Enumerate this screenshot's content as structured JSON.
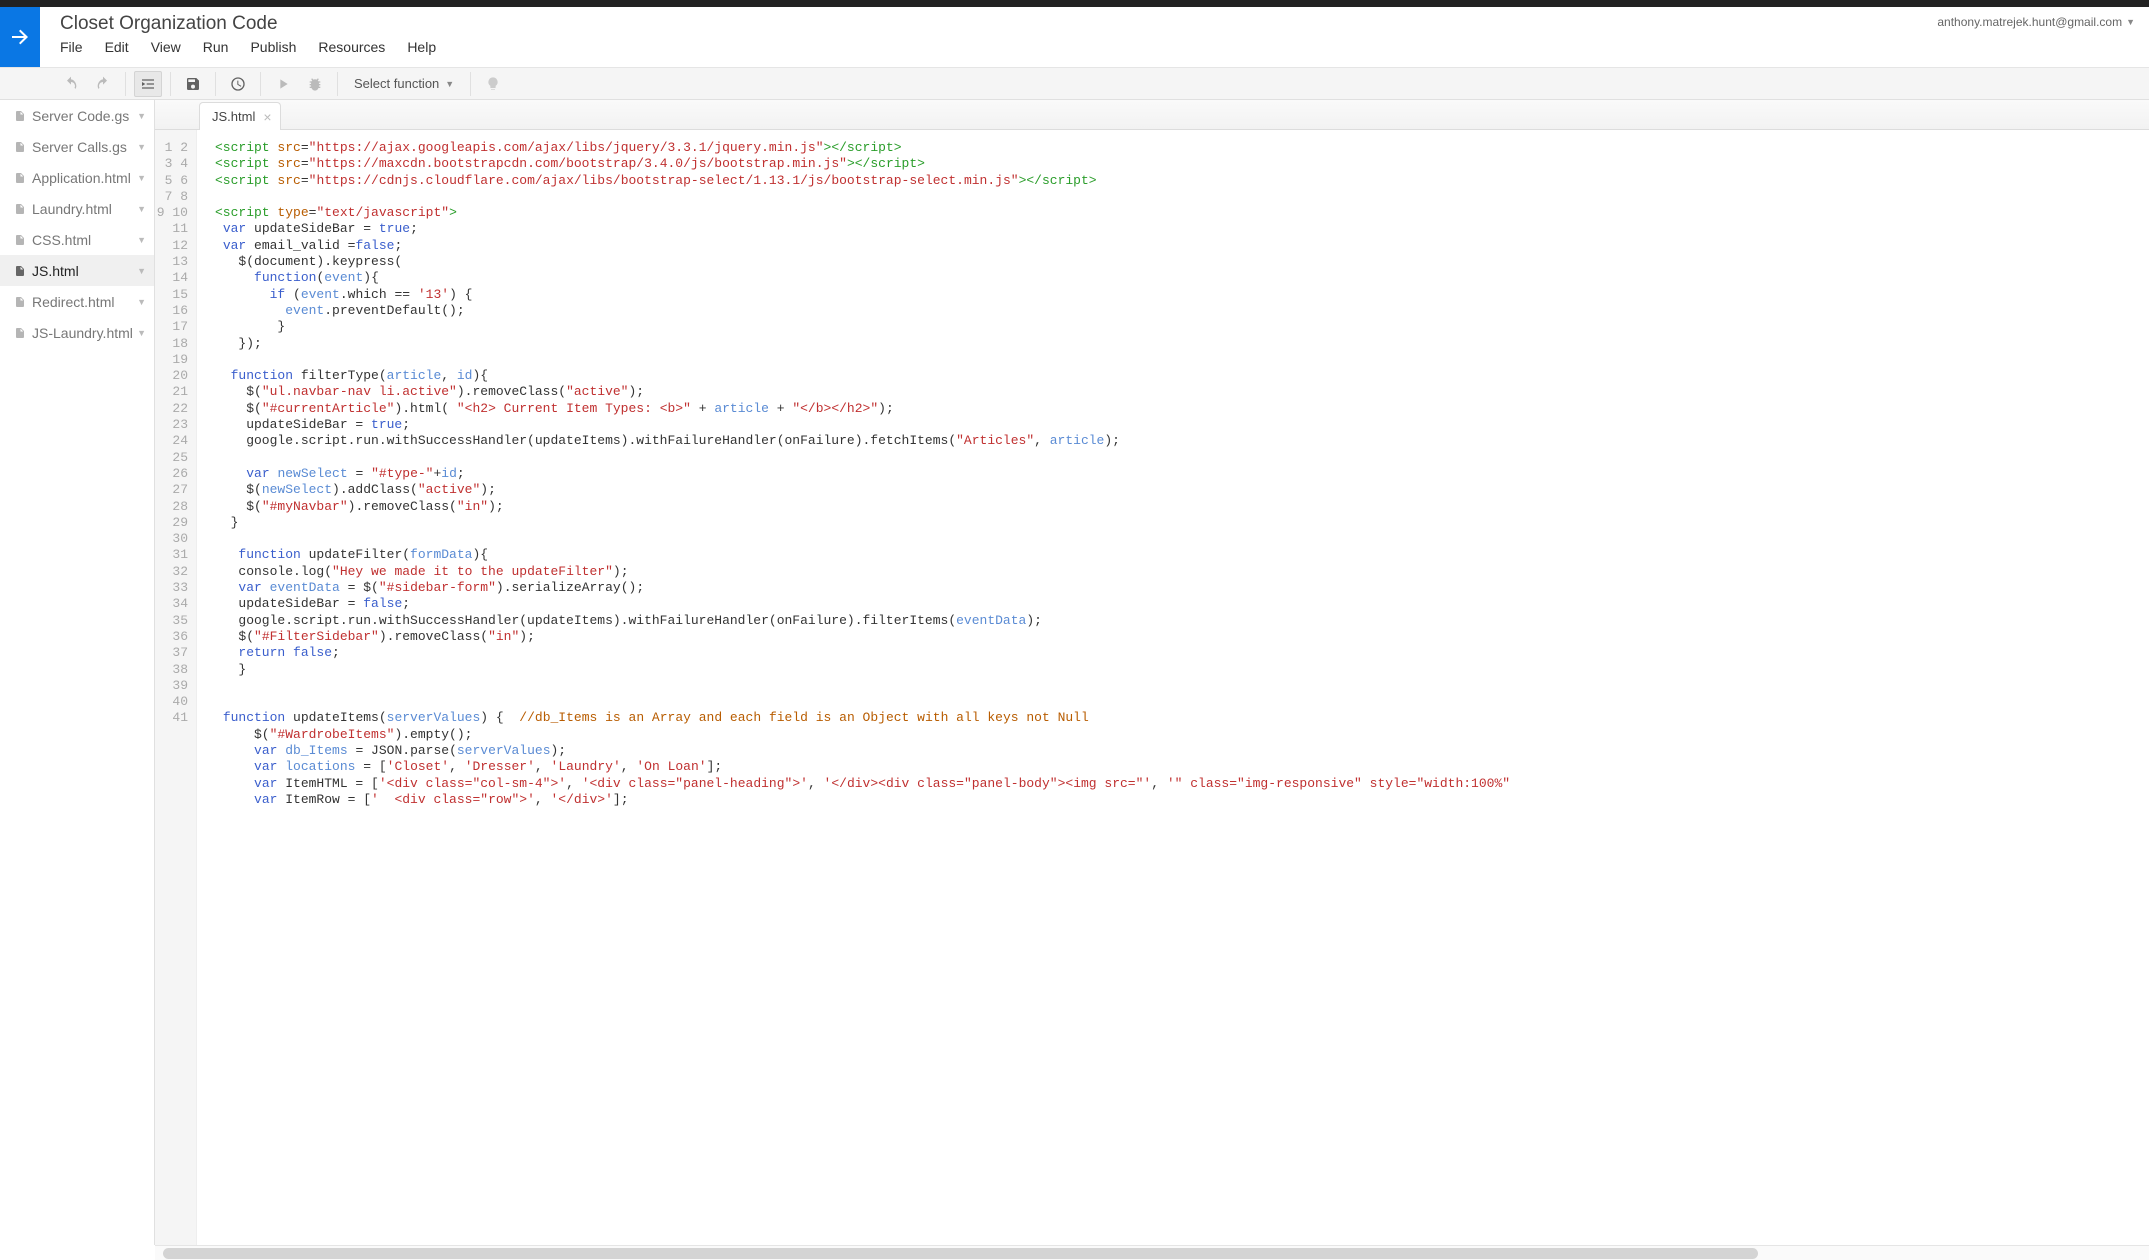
{
  "project_title": "Closet Organization Code",
  "user_email": "anthony.matrejek.hunt@gmail.com",
  "menubar": [
    "File",
    "Edit",
    "View",
    "Run",
    "Publish",
    "Resources",
    "Help"
  ],
  "toolbar": {
    "select_fn": "Select function"
  },
  "sidebar": {
    "items": [
      {
        "label": "Server Code.gs"
      },
      {
        "label": "Server Calls.gs"
      },
      {
        "label": "Application.html"
      },
      {
        "label": "Laundry.html"
      },
      {
        "label": "CSS.html"
      },
      {
        "label": "JS.html",
        "active": true
      },
      {
        "label": "Redirect.html"
      },
      {
        "label": "JS-Laundry.html"
      }
    ]
  },
  "editor": {
    "tab": "JS.html",
    "line_start": 1,
    "line_end": 41,
    "code_lines": [
      {
        "n": 1,
        "t": [
          [
            "tag",
            "<script"
          ],
          [
            "pl",
            " "
          ],
          [
            "attr",
            "src"
          ],
          [
            "pl",
            "="
          ],
          [
            "str",
            "\"https://ajax.googleapis.com/ajax/libs/jquery/3.3.1/jquery.min.js\""
          ],
          [
            "tag",
            "></script>"
          ]
        ]
      },
      {
        "n": 2,
        "t": [
          [
            "tag",
            "<script"
          ],
          [
            "pl",
            " "
          ],
          [
            "attr",
            "src"
          ],
          [
            "pl",
            "="
          ],
          [
            "str",
            "\"https://maxcdn.bootstrapcdn.com/bootstrap/3.4.0/js/bootstrap.min.js\""
          ],
          [
            "tag",
            "></script>"
          ]
        ]
      },
      {
        "n": 3,
        "t": [
          [
            "tag",
            "<script"
          ],
          [
            "pl",
            " "
          ],
          [
            "attr",
            "src"
          ],
          [
            "pl",
            "="
          ],
          [
            "str",
            "\"https://cdnjs.cloudflare.com/ajax/libs/bootstrap-select/1.13.1/js/bootstrap-select.min.js\""
          ],
          [
            "tag",
            "></script>"
          ]
        ]
      },
      {
        "n": 4,
        "t": []
      },
      {
        "n": 5,
        "t": [
          [
            "tag",
            "<script"
          ],
          [
            "pl",
            " "
          ],
          [
            "attr",
            "type"
          ],
          [
            "pl",
            "="
          ],
          [
            "str",
            "\"text/javascript\""
          ],
          [
            "tag",
            ">"
          ]
        ]
      },
      {
        "n": 6,
        "t": [
          [
            "pl",
            " "
          ],
          [
            "kw",
            "var"
          ],
          [
            "pl",
            " updateSideBar = "
          ],
          [
            "kw",
            "true"
          ],
          [
            "pl",
            ";"
          ]
        ]
      },
      {
        "n": 7,
        "t": [
          [
            "pl",
            " "
          ],
          [
            "kw",
            "var"
          ],
          [
            "pl",
            " email_valid ="
          ],
          [
            "kw",
            "false"
          ],
          [
            "pl",
            ";"
          ]
        ]
      },
      {
        "n": 8,
        "t": [
          [
            "pl",
            "   $(document).keypress("
          ]
        ]
      },
      {
        "n": 9,
        "t": [
          [
            "pl",
            "     "
          ],
          [
            "kw",
            "function"
          ],
          [
            "pl",
            "("
          ],
          [
            "id",
            "event"
          ],
          [
            "pl",
            "){"
          ]
        ]
      },
      {
        "n": 10,
        "t": [
          [
            "pl",
            "       "
          ],
          [
            "kw",
            "if"
          ],
          [
            "pl",
            " ("
          ],
          [
            "id",
            "event"
          ],
          [
            "pl",
            ".which == "
          ],
          [
            "str",
            "'13'"
          ],
          [
            "pl",
            ") {"
          ]
        ]
      },
      {
        "n": 11,
        "t": [
          [
            "pl",
            "         "
          ],
          [
            "id",
            "event"
          ],
          [
            "pl",
            ".preventDefault();"
          ]
        ]
      },
      {
        "n": 12,
        "t": [
          [
            "pl",
            "        }"
          ]
        ]
      },
      {
        "n": 13,
        "t": [
          [
            "pl",
            "   });"
          ]
        ]
      },
      {
        "n": 14,
        "t": []
      },
      {
        "n": 15,
        "t": [
          [
            "pl",
            "  "
          ],
          [
            "kw",
            "function"
          ],
          [
            "pl",
            " filterType("
          ],
          [
            "id",
            "article"
          ],
          [
            "pl",
            ", "
          ],
          [
            "id",
            "id"
          ],
          [
            "pl",
            "){"
          ]
        ]
      },
      {
        "n": 16,
        "t": [
          [
            "pl",
            "    $("
          ],
          [
            "str",
            "\"ul.navbar-nav li.active\""
          ],
          [
            "pl",
            ").removeClass("
          ],
          [
            "str",
            "\"active\""
          ],
          [
            "pl",
            ");"
          ]
        ]
      },
      {
        "n": 17,
        "t": [
          [
            "pl",
            "    $("
          ],
          [
            "str",
            "\"#currentArticle\""
          ],
          [
            "pl",
            ").html( "
          ],
          [
            "str",
            "\"<h2> Current Item Types: <b>\""
          ],
          [
            "pl",
            " + "
          ],
          [
            "id",
            "article"
          ],
          [
            "pl",
            " + "
          ],
          [
            "str",
            "\"</b></h2>\""
          ],
          [
            "pl",
            ");"
          ]
        ]
      },
      {
        "n": 18,
        "t": [
          [
            "pl",
            "    updateSideBar = "
          ],
          [
            "kw",
            "true"
          ],
          [
            "pl",
            ";"
          ]
        ]
      },
      {
        "n": 19,
        "t": [
          [
            "pl",
            "    google.script.run.withSuccessHandler(updateItems).withFailureHandler(onFailure).fetchItems("
          ],
          [
            "str",
            "\"Articles\""
          ],
          [
            "pl",
            ", "
          ],
          [
            "id",
            "article"
          ],
          [
            "pl",
            ");"
          ]
        ]
      },
      {
        "n": 20,
        "t": []
      },
      {
        "n": 21,
        "t": [
          [
            "pl",
            "    "
          ],
          [
            "kw",
            "var"
          ],
          [
            "pl",
            " "
          ],
          [
            "id",
            "newSelect"
          ],
          [
            "pl",
            " = "
          ],
          [
            "str",
            "\"#type-\""
          ],
          [
            "pl",
            "+"
          ],
          [
            "id",
            "id"
          ],
          [
            "pl",
            ";"
          ]
        ]
      },
      {
        "n": 22,
        "t": [
          [
            "pl",
            "    $("
          ],
          [
            "id",
            "newSelect"
          ],
          [
            "pl",
            ").addClass("
          ],
          [
            "str",
            "\"active\""
          ],
          [
            "pl",
            ");"
          ]
        ]
      },
      {
        "n": 23,
        "t": [
          [
            "pl",
            "    $("
          ],
          [
            "str",
            "\"#myNavbar\""
          ],
          [
            "pl",
            ").removeClass("
          ],
          [
            "str",
            "\"in\""
          ],
          [
            "pl",
            ");"
          ]
        ]
      },
      {
        "n": 24,
        "t": [
          [
            "pl",
            "  }"
          ]
        ]
      },
      {
        "n": 25,
        "t": []
      },
      {
        "n": 26,
        "t": [
          [
            "pl",
            "   "
          ],
          [
            "kw",
            "function"
          ],
          [
            "pl",
            " updateFilter("
          ],
          [
            "id",
            "formData"
          ],
          [
            "pl",
            "){"
          ]
        ]
      },
      {
        "n": 27,
        "t": [
          [
            "pl",
            "   console.log("
          ],
          [
            "str",
            "\"Hey we made it to the updateFilter\""
          ],
          [
            "pl",
            ");"
          ]
        ]
      },
      {
        "n": 28,
        "t": [
          [
            "pl",
            "   "
          ],
          [
            "kw",
            "var"
          ],
          [
            "pl",
            " "
          ],
          [
            "id",
            "eventData"
          ],
          [
            "pl",
            " = $("
          ],
          [
            "str",
            "\"#sidebar-form\""
          ],
          [
            "pl",
            ").serializeArray();"
          ]
        ]
      },
      {
        "n": 29,
        "t": [
          [
            "pl",
            "   updateSideBar = "
          ],
          [
            "kw",
            "false"
          ],
          [
            "pl",
            ";"
          ]
        ]
      },
      {
        "n": 30,
        "t": [
          [
            "pl",
            "   google.script.run.withSuccessHandler(updateItems).withFailureHandler(onFailure).filterItems("
          ],
          [
            "id",
            "eventData"
          ],
          [
            "pl",
            ");"
          ]
        ]
      },
      {
        "n": 31,
        "t": [
          [
            "pl",
            "   $("
          ],
          [
            "str",
            "\"#FilterSidebar\""
          ],
          [
            "pl",
            ").removeClass("
          ],
          [
            "str",
            "\"in\""
          ],
          [
            "pl",
            ");"
          ]
        ]
      },
      {
        "n": 32,
        "t": [
          [
            "pl",
            "   "
          ],
          [
            "kw",
            "return"
          ],
          [
            "pl",
            " "
          ],
          [
            "kw",
            "false"
          ],
          [
            "pl",
            ";"
          ]
        ]
      },
      {
        "n": 33,
        "t": [
          [
            "pl",
            "   }"
          ]
        ]
      },
      {
        "n": 34,
        "t": []
      },
      {
        "n": 35,
        "t": []
      },
      {
        "n": 36,
        "t": [
          [
            "pl",
            " "
          ],
          [
            "kw",
            "function"
          ],
          [
            "pl",
            " updateItems("
          ],
          [
            "id",
            "serverValues"
          ],
          [
            "pl",
            ") {  "
          ],
          [
            "cm",
            "//db_Items is an Array and each field is an Object with all keys not Null"
          ]
        ]
      },
      {
        "n": 37,
        "t": [
          [
            "pl",
            "     $("
          ],
          [
            "str",
            "\"#WardrobeItems\""
          ],
          [
            "pl",
            ").empty();"
          ]
        ]
      },
      {
        "n": 38,
        "t": [
          [
            "pl",
            "     "
          ],
          [
            "kw",
            "var"
          ],
          [
            "pl",
            " "
          ],
          [
            "id",
            "db_Items"
          ],
          [
            "pl",
            " = JSON.parse("
          ],
          [
            "id",
            "serverValues"
          ],
          [
            "pl",
            ");"
          ]
        ]
      },
      {
        "n": 39,
        "t": [
          [
            "pl",
            "     "
          ],
          [
            "kw",
            "var"
          ],
          [
            "pl",
            " "
          ],
          [
            "id",
            "locations"
          ],
          [
            "pl",
            " = ["
          ],
          [
            "str",
            "'Closet'"
          ],
          [
            "pl",
            ", "
          ],
          [
            "str",
            "'Dresser'"
          ],
          [
            "pl",
            ", "
          ],
          [
            "str",
            "'Laundry'"
          ],
          [
            "pl",
            ", "
          ],
          [
            "str",
            "'On Loan'"
          ],
          [
            "pl",
            "];"
          ]
        ]
      },
      {
        "n": 40,
        "t": [
          [
            "pl",
            "     "
          ],
          [
            "kw",
            "var"
          ],
          [
            "pl",
            " ItemHTML = ["
          ],
          [
            "str",
            "'<div class=\"col-sm-4\">'"
          ],
          [
            "pl",
            ", "
          ],
          [
            "str",
            "'<div class=\"panel-heading\">'"
          ],
          [
            "pl",
            ", "
          ],
          [
            "str",
            "'</div><div class=\"panel-body\"><img src=\"'"
          ],
          [
            "pl",
            ", "
          ],
          [
            "str",
            "'\" class=\"img-responsive\" style=\"width:100%\""
          ]
        ]
      },
      {
        "n": 41,
        "t": [
          [
            "pl",
            "     "
          ],
          [
            "kw",
            "var"
          ],
          [
            "pl",
            " ItemRow = ["
          ],
          [
            "str",
            "'  <div class=\"row\">'"
          ],
          [
            "pl",
            ", "
          ],
          [
            "str",
            "'</div>'"
          ],
          [
            "pl",
            "];"
          ]
        ]
      }
    ]
  }
}
